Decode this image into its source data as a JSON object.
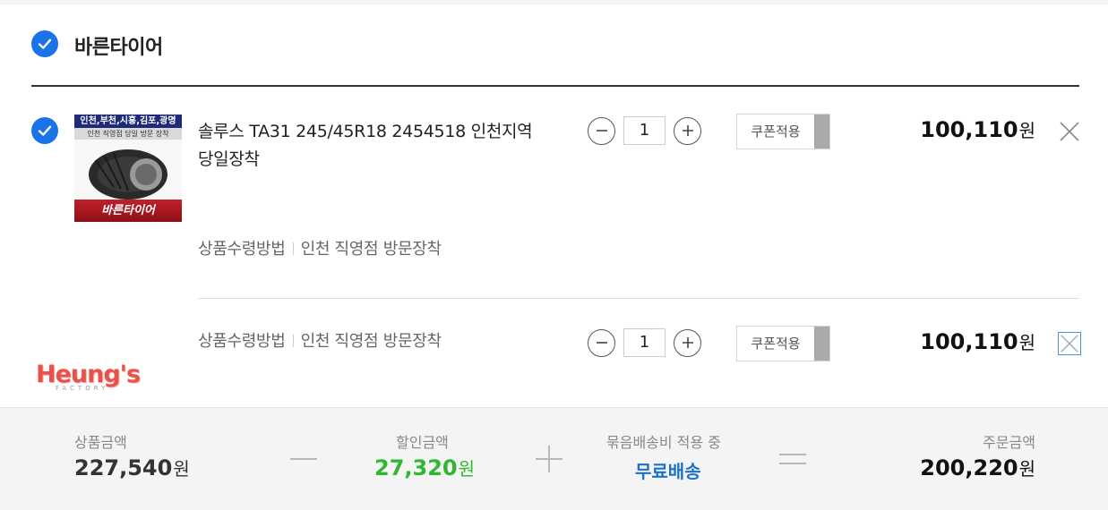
{
  "store": {
    "name": "바른타이어"
  },
  "product": {
    "name": "솔루스 TA31 245/45R18 2454518 인천지역 당일장착",
    "thumb_banner_top": "인천,부천,시흥,김포,광명",
    "thumb_banner_sub": "인천 직영점 당일 방문 장착",
    "thumb_badge": "바른타이어"
  },
  "rows": [
    {
      "option_label": "상품수령방법",
      "option_value": "인천 직영점 방문장착",
      "quantity": "1",
      "coupon_label": "쿠폰적용",
      "price": "100,110",
      "currency": "원"
    },
    {
      "option_label": "상품수령방법",
      "option_value": "인천 직영점 방문장착",
      "quantity": "1",
      "coupon_label": "쿠폰적용",
      "price": "100,110",
      "currency": "원"
    }
  ],
  "watermark": {
    "text": "Heung's",
    "sub": "FACTORY"
  },
  "summary": {
    "product_total_label": "상품금액",
    "product_total": "227,540",
    "discount_label": "할인금액",
    "discount": "27,320",
    "shipping_label": "묶음배송비 적용 중",
    "shipping_value": "무료배송",
    "order_total_label": "주문금액",
    "order_total": "200,220",
    "currency": "원"
  },
  "colors": {
    "accent": "#1a73e8",
    "discount": "#2db82d",
    "shipping": "#1a73c8"
  },
  "icons": [
    "check-icon",
    "minus-icon",
    "plus-icon",
    "close-icon"
  ]
}
